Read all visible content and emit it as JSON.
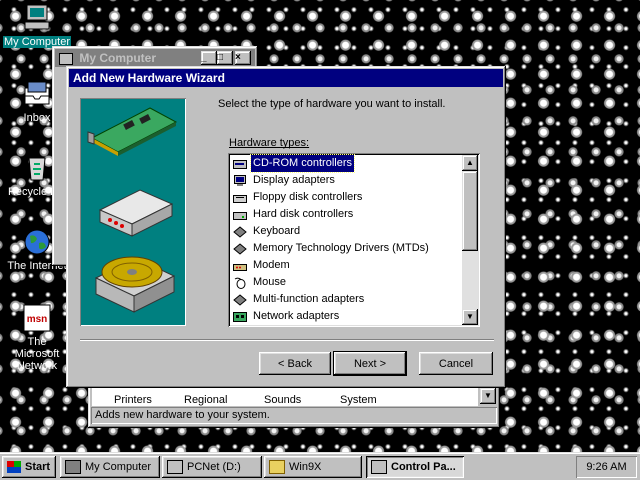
{
  "desktop": {
    "icons": [
      {
        "label": "My Computer"
      },
      {
        "label": "Inbox"
      },
      {
        "label": "Recycle Bin"
      },
      {
        "label": "The Internet"
      },
      {
        "label": "The Microsoft Network"
      }
    ]
  },
  "my_computer_window": {
    "title": "My Computer",
    "partial_items": [
      "Printers",
      "Regional",
      "Sounds",
      "System"
    ],
    "status_text": "Adds new hardware to your system."
  },
  "wizard": {
    "title": "Add New Hardware Wizard",
    "instruction": "Select the type of hardware you want to install.",
    "list_label": "Hardware types:",
    "hardware_types": [
      {
        "label": "CD-ROM controllers",
        "icon": "cdrom-controller-icon",
        "selected": true
      },
      {
        "label": "Display adapters",
        "icon": "display-adapter-icon"
      },
      {
        "label": "Floppy disk controllers",
        "icon": "floppy-controller-icon"
      },
      {
        "label": "Hard disk controllers",
        "icon": "hard-disk-controller-icon"
      },
      {
        "label": "Keyboard",
        "icon": "keyboard-icon"
      },
      {
        "label": "Memory Technology Drivers (MTDs)",
        "icon": "mtd-icon"
      },
      {
        "label": "Modem",
        "icon": "modem-icon"
      },
      {
        "label": "Mouse",
        "icon": "mouse-icon"
      },
      {
        "label": "Multi-function adapters",
        "icon": "multifunction-icon"
      },
      {
        "label": "Network adapters",
        "icon": "network-adapter-icon"
      }
    ],
    "buttons": {
      "back": "< Back",
      "next": "Next >",
      "cancel": "Cancel"
    }
  },
  "taskbar": {
    "start_label": "Start",
    "tasks": [
      {
        "label": "My Computer"
      },
      {
        "label": "PCNet (D:)"
      },
      {
        "label": "Win9X"
      },
      {
        "label": "Control Pa...",
        "active": true
      }
    ],
    "clock": "9:26 AM"
  }
}
